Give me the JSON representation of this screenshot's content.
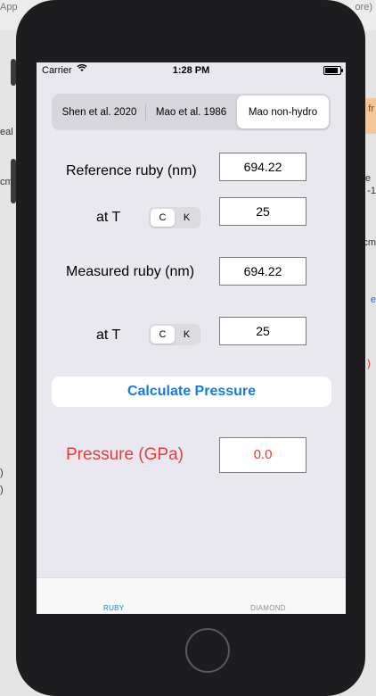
{
  "background": {
    "top_left_text": "App",
    "top_right_text": "ore)",
    "left_snippets": [
      "eal",
      "cm",
      ")",
      ")"
    ],
    "right_snippets": [
      "fr",
      "e",
      "-1",
      "cm",
      "e",
      ")"
    ]
  },
  "status_bar": {
    "carrier": "Carrier",
    "time": "1:28 PM"
  },
  "method_segments": [
    {
      "label": "Shen et al. 2020",
      "selected": false
    },
    {
      "label": "Mao et al. 1986",
      "selected": false
    },
    {
      "label": "Mao non-hydro",
      "selected": true
    }
  ],
  "reference": {
    "label": "Reference ruby (nm)",
    "value": "694.22",
    "temp_label": "at T",
    "temp_units": [
      "C",
      "K"
    ],
    "temp_unit_selected": "C",
    "temp_value": "25"
  },
  "measured": {
    "label": "Measured ruby (nm)",
    "value": "694.22",
    "temp_label": "at T",
    "temp_units": [
      "C",
      "K"
    ],
    "temp_unit_selected": "C",
    "temp_value": "25"
  },
  "calculate_button": "Calculate Pressure",
  "result": {
    "label": "Pressure (GPa)",
    "value": "0.0"
  },
  "tabs": [
    {
      "label": "RUBY",
      "active": true
    },
    {
      "label": "DIAMOND",
      "active": false
    }
  ],
  "colors": {
    "accent": "#1a7ae0",
    "pressure": "#ea3a3a"
  }
}
